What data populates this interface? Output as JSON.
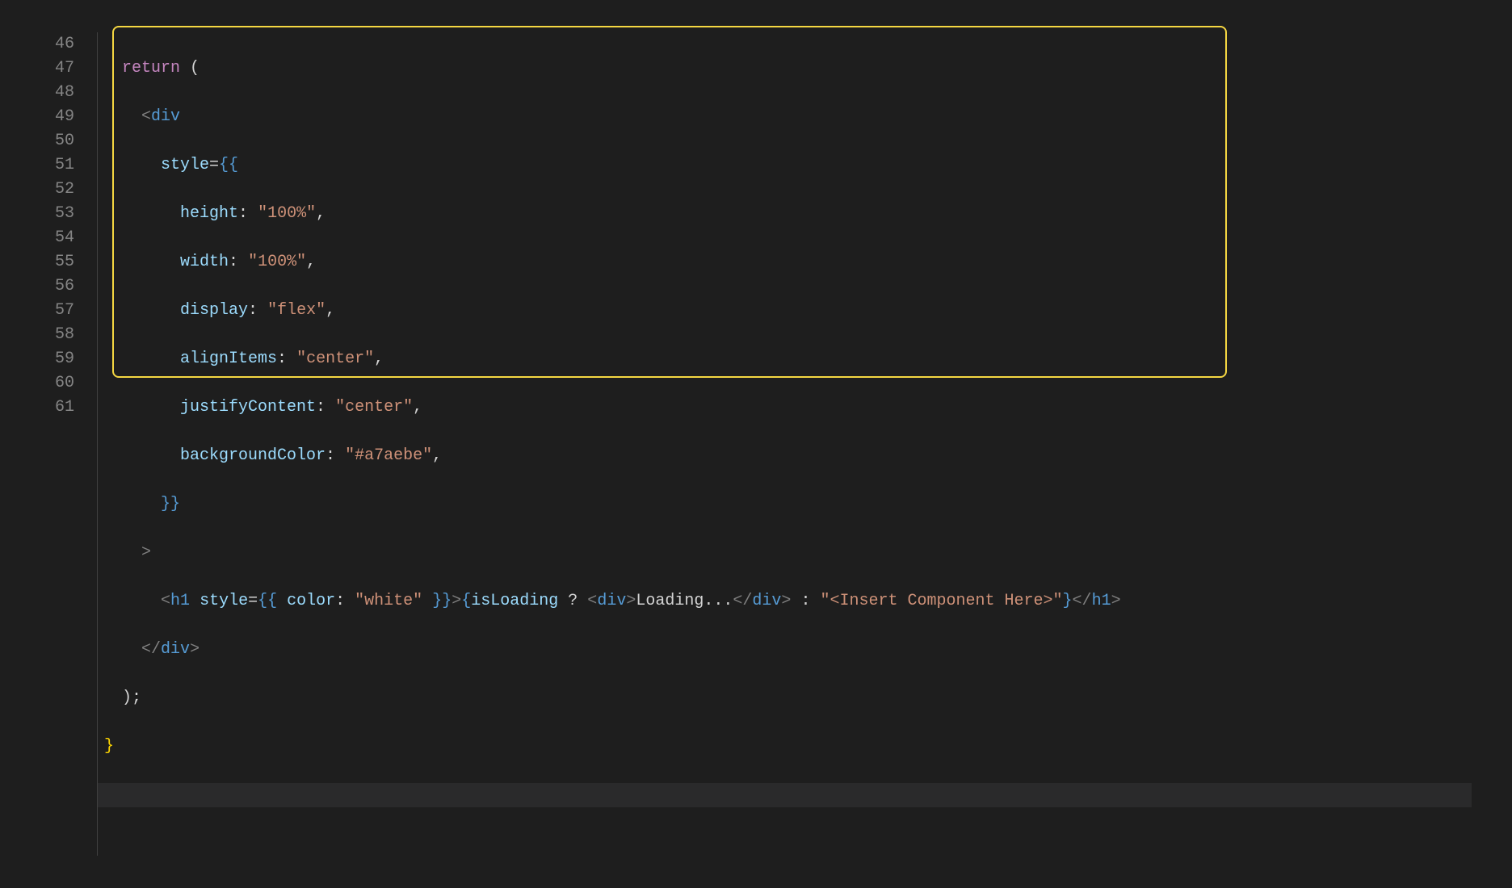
{
  "editor": {
    "line_numbers": [
      "46",
      "47",
      "48",
      "49",
      "50",
      "51",
      "52",
      "53",
      "54",
      "55",
      "56",
      "57",
      "58",
      "59",
      "60",
      "61"
    ],
    "tokens": {
      "kw_return": "return",
      "lparen": " (",
      "lt": "<",
      "gt": ">",
      "slash": "/",
      "tag_div": "div",
      "tag_h1": "h1",
      "attr_style": "style",
      "eq": "=",
      "dbl_lbrace": "{{",
      "dbl_rbrace": "}}",
      "lbrace": "{",
      "rbrace": "}",
      "prop_height": "height",
      "prop_width": "width",
      "prop_display": "display",
      "prop_alignItems": "alignItems",
      "prop_justifyContent": "justifyContent",
      "prop_backgroundColor": "backgroundColor",
      "prop_color": "color",
      "var_isLoading": "isLoading",
      "colon": ":",
      "comma": ",",
      "qmark": " ? ",
      "tern_colon": " : ",
      "str_100pct": "\"100%\"",
      "str_flex": "\"flex\"",
      "str_center": "\"center\"",
      "str_bgcolor": "\"#a7aebe\"",
      "str_white": "\"white\"",
      "str_insert": "\"<Insert Component Here>\"",
      "txt_loading": "Loading...",
      "rparen_semi": ");",
      "close_curly": "}"
    },
    "indent": {
      "i2": "  ",
      "i4": "    ",
      "i6": "      ",
      "i8": "        "
    }
  }
}
